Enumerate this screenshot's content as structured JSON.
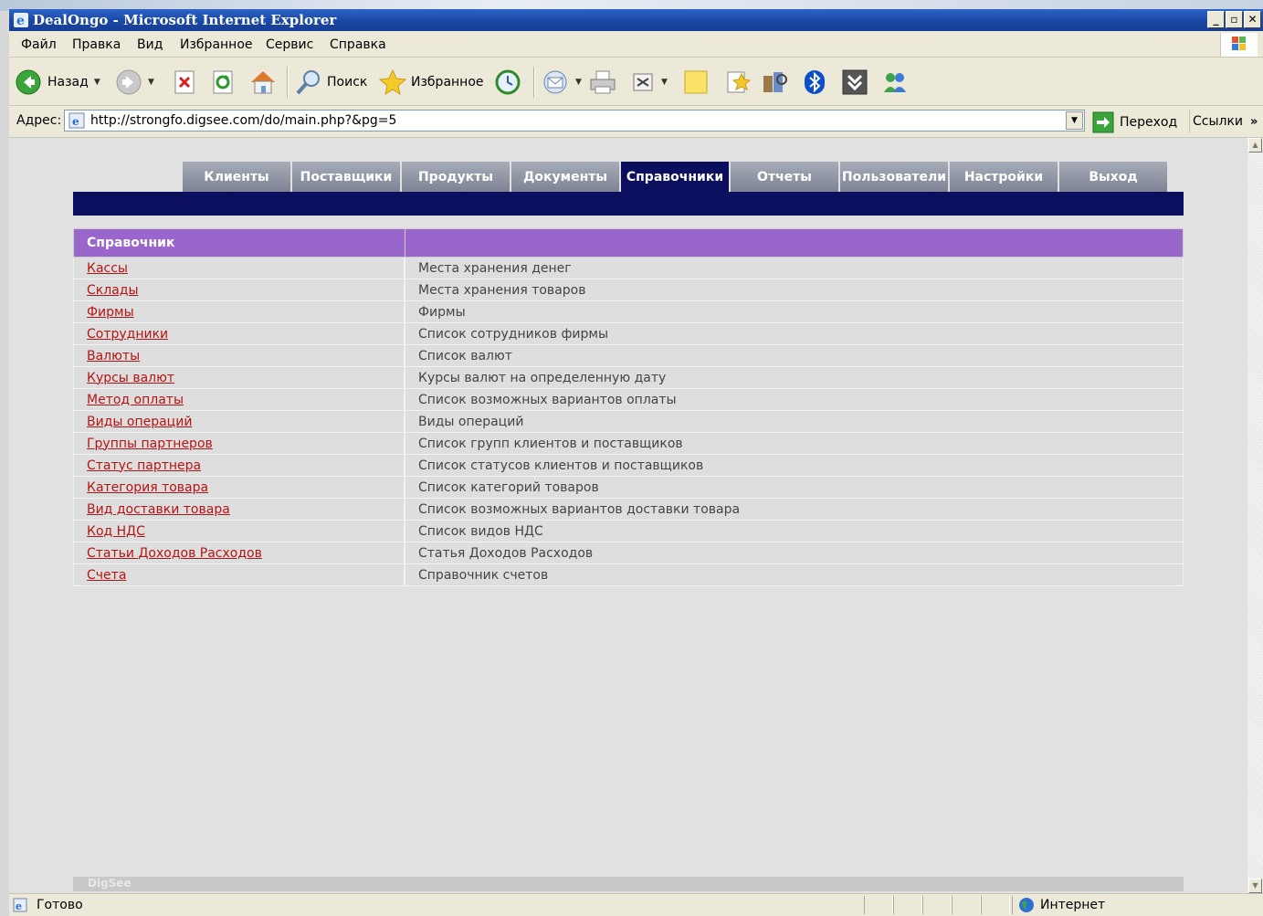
{
  "window": {
    "title": "DealOngo - Microsoft Internet Explorer"
  },
  "menu": [
    "Файл",
    "Правка",
    "Вид",
    "Избранное",
    "Сервис",
    "Справка"
  ],
  "toolbar": {
    "back": "Назад",
    "search": "Поиск",
    "favorites": "Избранное"
  },
  "address": {
    "label": "Адрес:",
    "url": "http://strongfo.digsee.com/do/main.php?&pg=5",
    "go": "Переход",
    "links": "Ссылки"
  },
  "nav": {
    "tabs": [
      "Клиенты",
      "Поставщики",
      "Продукты",
      "Документы",
      "Справочники",
      "Отчеты",
      "Пользователи",
      "Настройки",
      "Выход"
    ],
    "active": "Справочники"
  },
  "directory": {
    "header": "Справочник",
    "rows": [
      {
        "name": "Кассы",
        "desc": "Места хранения денег"
      },
      {
        "name": "Склады",
        "desc": "Места хранения товаров"
      },
      {
        "name": "Фирмы",
        "desc": "Фирмы"
      },
      {
        "name": "Сотрудники",
        "desc": "Список сотрудников фирмы"
      },
      {
        "name": "Валюты",
        "desc": "Список валют"
      },
      {
        "name": "Курсы валют",
        "desc": "Курсы валют на определенную дату"
      },
      {
        "name": "Метод оплаты",
        "desc": "Список возможных вариантов оплаты"
      },
      {
        "name": "Виды операций",
        "desc": "Виды операций"
      },
      {
        "name": "Группы партнеров",
        "desc": "Список групп клиентов и поставщиков"
      },
      {
        "name": "Статус партнера",
        "desc": "Список статусов клиентов и поставщиков"
      },
      {
        "name": "Категория товара",
        "desc": "Список категорий товаров"
      },
      {
        "name": "Вид доставки товара",
        "desc": "Список возможных вариантов доставки товара"
      },
      {
        "name": "Код НДС",
        "desc": "Список видов НДС"
      },
      {
        "name": "Статьи Доходов Расходов",
        "desc": "Статья Доходов Расходов"
      },
      {
        "name": "Счета",
        "desc": "Справочник счетов"
      }
    ]
  },
  "footer": {
    "brand": "DigSee"
  },
  "status": {
    "text": "Готово",
    "zone": "Интернет"
  }
}
